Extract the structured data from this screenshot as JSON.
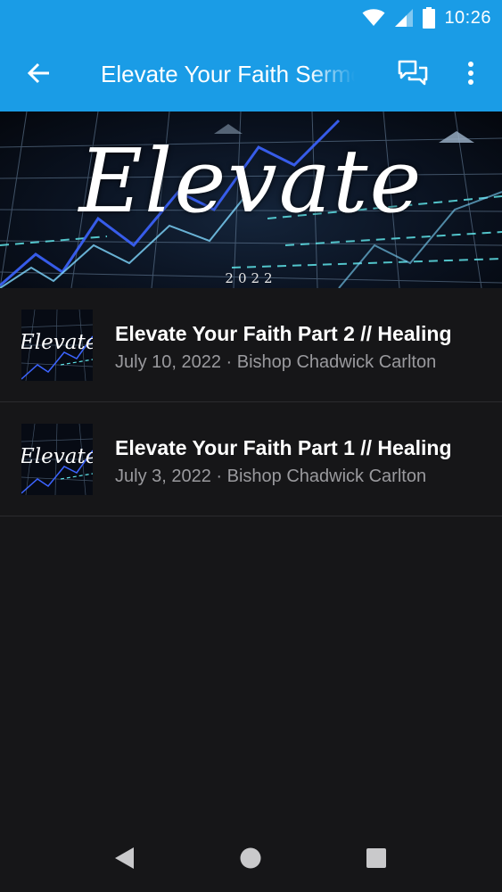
{
  "status_bar": {
    "time": "10:26",
    "icons": [
      "wifi-icon",
      "cell-signal-icon",
      "battery-icon"
    ]
  },
  "app_bar": {
    "title": "Elevate Your Faith Sermons",
    "icons": [
      "back-arrow-icon",
      "chat-icon",
      "more-vert-icon"
    ],
    "color": "#1a9ce6"
  },
  "banner": {
    "title": "Elevate",
    "year": "2022"
  },
  "sermons": [
    {
      "title": "Elevate Your Faith Part 2 // Healing",
      "meta": "July 10, 2022 · Bishop Chadwick Carlton",
      "thumb_text": "Elevate"
    },
    {
      "title": "Elevate Your Faith Part 1 // Healing",
      "meta": "July 3, 2022 · Bishop Chadwick Carlton",
      "thumb_text": "Elevate"
    }
  ],
  "nav_bar": {
    "icons": [
      "back-triangle-icon",
      "home-circle-icon",
      "recents-square-icon"
    ]
  },
  "colors": {
    "accent": "#1a9ce6",
    "background": "#161618",
    "meta_text": "#9a9a9e"
  }
}
